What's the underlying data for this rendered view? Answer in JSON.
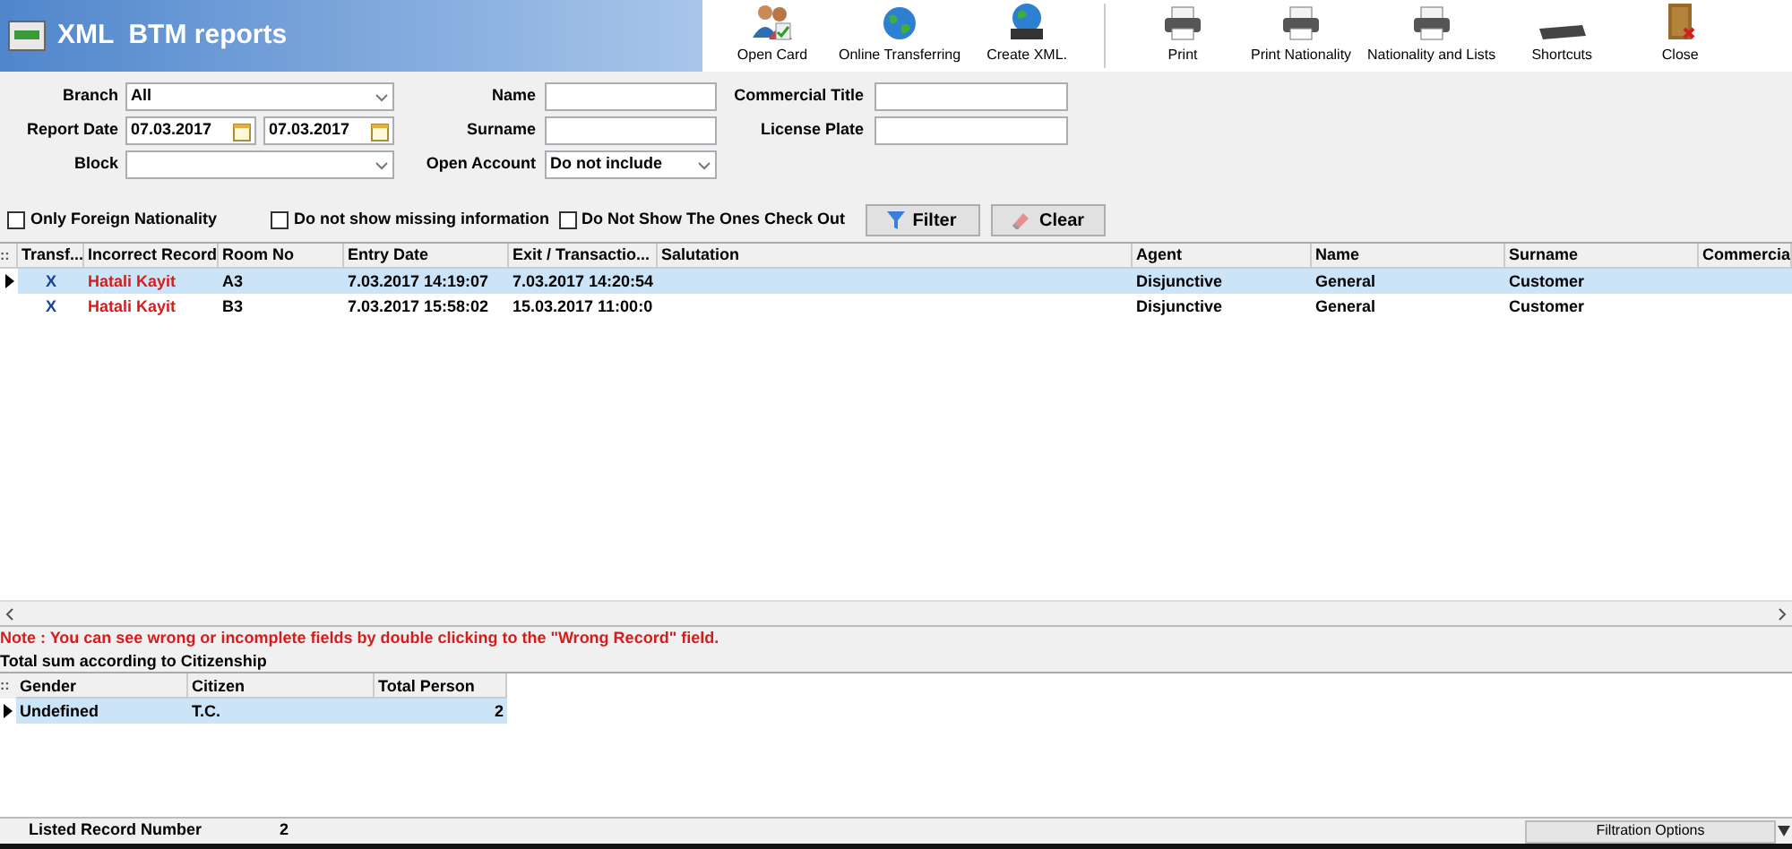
{
  "window": {
    "title": "XML  BTM reports"
  },
  "toolbar": {
    "groups": [
      [
        {
          "label": "Open Card",
          "kind": "people"
        },
        {
          "label": "Online Transferring",
          "kind": "globe"
        },
        {
          "label": "Create XML.",
          "kind": "xml"
        }
      ],
      [
        {
          "label": "Print",
          "kind": "printer"
        },
        {
          "label": "Print Nationality",
          "kind": "printer"
        },
        {
          "label": "Nationality and Lists",
          "kind": "printer"
        },
        {
          "label": "Shortcuts",
          "kind": "keyboard"
        },
        {
          "label": "Close",
          "kind": "door"
        }
      ]
    ]
  },
  "filters": {
    "branch": {
      "label": "Branch",
      "value": "All"
    },
    "report_date": {
      "label": "Report Date",
      "from": "07.03.2017",
      "to": "07.03.2017"
    },
    "block": {
      "label": "Block"
    },
    "name": {
      "label": "Name"
    },
    "surname": {
      "label": "Surname"
    },
    "open_account": {
      "label": "Open Account",
      "value": "Do not include"
    },
    "commercial_title": {
      "label": "Commercial Title"
    },
    "license_plate": {
      "label": "License Plate"
    }
  },
  "checkboxes": [
    {
      "label": "Only Foreign Nationality",
      "checked": false
    },
    {
      "label": "Do not show missing information",
      "checked": false
    },
    {
      "label": "Do Not Show The Ones Check Out",
      "checked": false
    }
  ],
  "buttons": [
    {
      "label": "Filter",
      "kind": "filter"
    },
    {
      "label": "Clear",
      "kind": "clear"
    }
  ],
  "table": {
    "corner": "::",
    "columns": [
      "Transf...",
      "Incorrect Record",
      "Room No",
      "Entry Date",
      "Exit / Transactio...",
      "Salutation",
      "Agent",
      "Name",
      "Surname",
      "Commercia"
    ],
    "rows": [
      {
        "selected": true,
        "transfer": "X",
        "incorrect_record": "Hatali Kayit",
        "room_no": "A3",
        "entry_date": "7.03.2017 14:19:07",
        "exit_date": "7.03.2017 14:20:54",
        "agent": "Disjunctive",
        "name": "General",
        "surname": "Customer"
      },
      {
        "selected": false,
        "transfer": "X",
        "incorrect_record": "Hatali Kayit",
        "room_no": "B3",
        "entry_date": "7.03.2017 15:58:02",
        "exit_date": "15.03.2017 11:00:0",
        "agent": "Disjunctive",
        "name": "General",
        "surname": "Customer"
      }
    ]
  },
  "note": "Note : You can see wrong or incomplete fields by double clicking to the \"Wrong Record\" field.",
  "summary": {
    "title": "Total sum according to Citizenship",
    "corner": "::",
    "columns": [
      "Gender",
      "Citizen",
      "Total Person"
    ],
    "rows": [
      {
        "selected": true,
        "gender": "Undefined",
        "citizen": "T.C.",
        "total": "2"
      }
    ]
  },
  "status_bar": {
    "label": "Listed Record Number",
    "value": "2",
    "options": "Filtration Options"
  }
}
